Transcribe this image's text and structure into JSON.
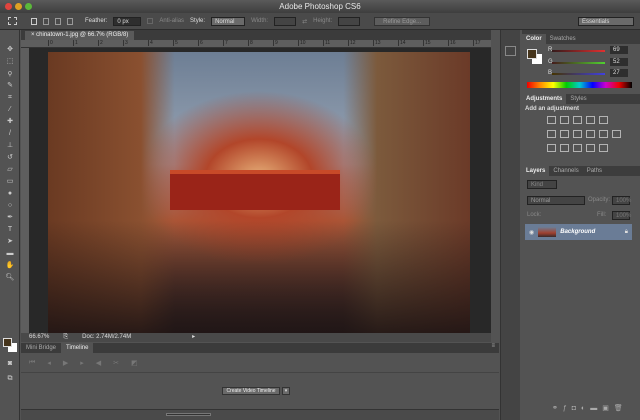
{
  "app": {
    "title": "Adobe Photoshop CS6"
  },
  "options": {
    "feather_label": "Feather:",
    "feather_value": "0 px",
    "antialias_label": "Anti-alias",
    "style_label": "Style:",
    "style_value": "Normal",
    "width_label": "Width:",
    "height_label": "Height:",
    "refine_label": "Refine Edge...",
    "workspace": "Essentials"
  },
  "document": {
    "tab": "chinatown-1.jpg @ 66.7% (RGB/8)",
    "ruler_ticks": [
      "0",
      "1",
      "2",
      "3",
      "4",
      "5",
      "6",
      "7",
      "8",
      "9",
      "10",
      "11",
      "12",
      "13",
      "14",
      "15",
      "16",
      "17"
    ],
    "zoom": "66.67%",
    "doc_size": "Doc: 2.74M/2.74M"
  },
  "timeline": {
    "tabs": [
      "Mini Bridge",
      "Timeline"
    ],
    "create_button": "Create Video Timeline"
  },
  "color_panel": {
    "tabs": [
      "Color",
      "Swatches"
    ],
    "r_label": "R",
    "g_label": "G",
    "b_label": "B",
    "r": "69",
    "g": "52",
    "b": "27",
    "foreground": "#45341b"
  },
  "adjustments_panel": {
    "tabs": [
      "Adjustments",
      "Styles"
    ],
    "heading": "Add an adjustment"
  },
  "layers_panel": {
    "tabs": [
      "Layers",
      "Channels",
      "Paths"
    ],
    "filter": "Kind",
    "blend_mode": "Normal",
    "opacity_label": "Opacity:",
    "opacity": "100%",
    "lock_label": "Lock:",
    "fill_label": "Fill:",
    "fill": "100%",
    "layers": [
      {
        "name": "Background",
        "visible": true,
        "locked": true
      }
    ]
  }
}
